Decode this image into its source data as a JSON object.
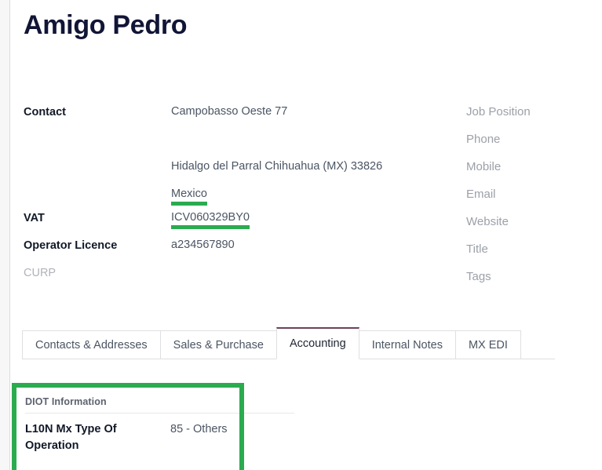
{
  "record": {
    "title": "Amigo Pedro"
  },
  "colors": {
    "highlight_green": "#2bab4f",
    "active_tab_accent": "#6b4458",
    "title_color": "#111536",
    "muted_label": "#9ca0a8"
  },
  "left_column": {
    "contact": {
      "label": "Contact",
      "address": {
        "street": "Campobasso Oeste  77",
        "street2": "",
        "city": "Hidalgo del Parral",
        "state": "Chihuahua (MX)",
        "zip": "33826",
        "country": "Mexico"
      }
    },
    "vat": {
      "label": "VAT",
      "value": "ICV060329BY0"
    },
    "operator_licence": {
      "label": "Operator Licence",
      "value": "a234567890"
    },
    "curp": {
      "label": "CURP",
      "value": ""
    }
  },
  "right_column": {
    "fields": [
      {
        "label": "Job Position",
        "value": ""
      },
      {
        "label": "Phone",
        "value": ""
      },
      {
        "label": "Mobile",
        "value": ""
      },
      {
        "label": "Email",
        "value": ""
      },
      {
        "label": "Website",
        "value": ""
      },
      {
        "label": "Title",
        "value": ""
      },
      {
        "label": "Tags",
        "value": ""
      }
    ]
  },
  "notebook": {
    "tabs": [
      {
        "label": "Contacts & Addresses",
        "active": false
      },
      {
        "label": "Sales & Purchase",
        "active": false
      },
      {
        "label": "Accounting",
        "active": true
      },
      {
        "label": "Internal Notes",
        "active": false
      },
      {
        "label": "MX EDI",
        "active": false
      }
    ]
  },
  "accounting_tab": {
    "diot_section": {
      "title": "DIOT Information",
      "rows": [
        {
          "label": "L10N Mx Type Of Operation",
          "value": "85 - Others"
        }
      ]
    }
  }
}
